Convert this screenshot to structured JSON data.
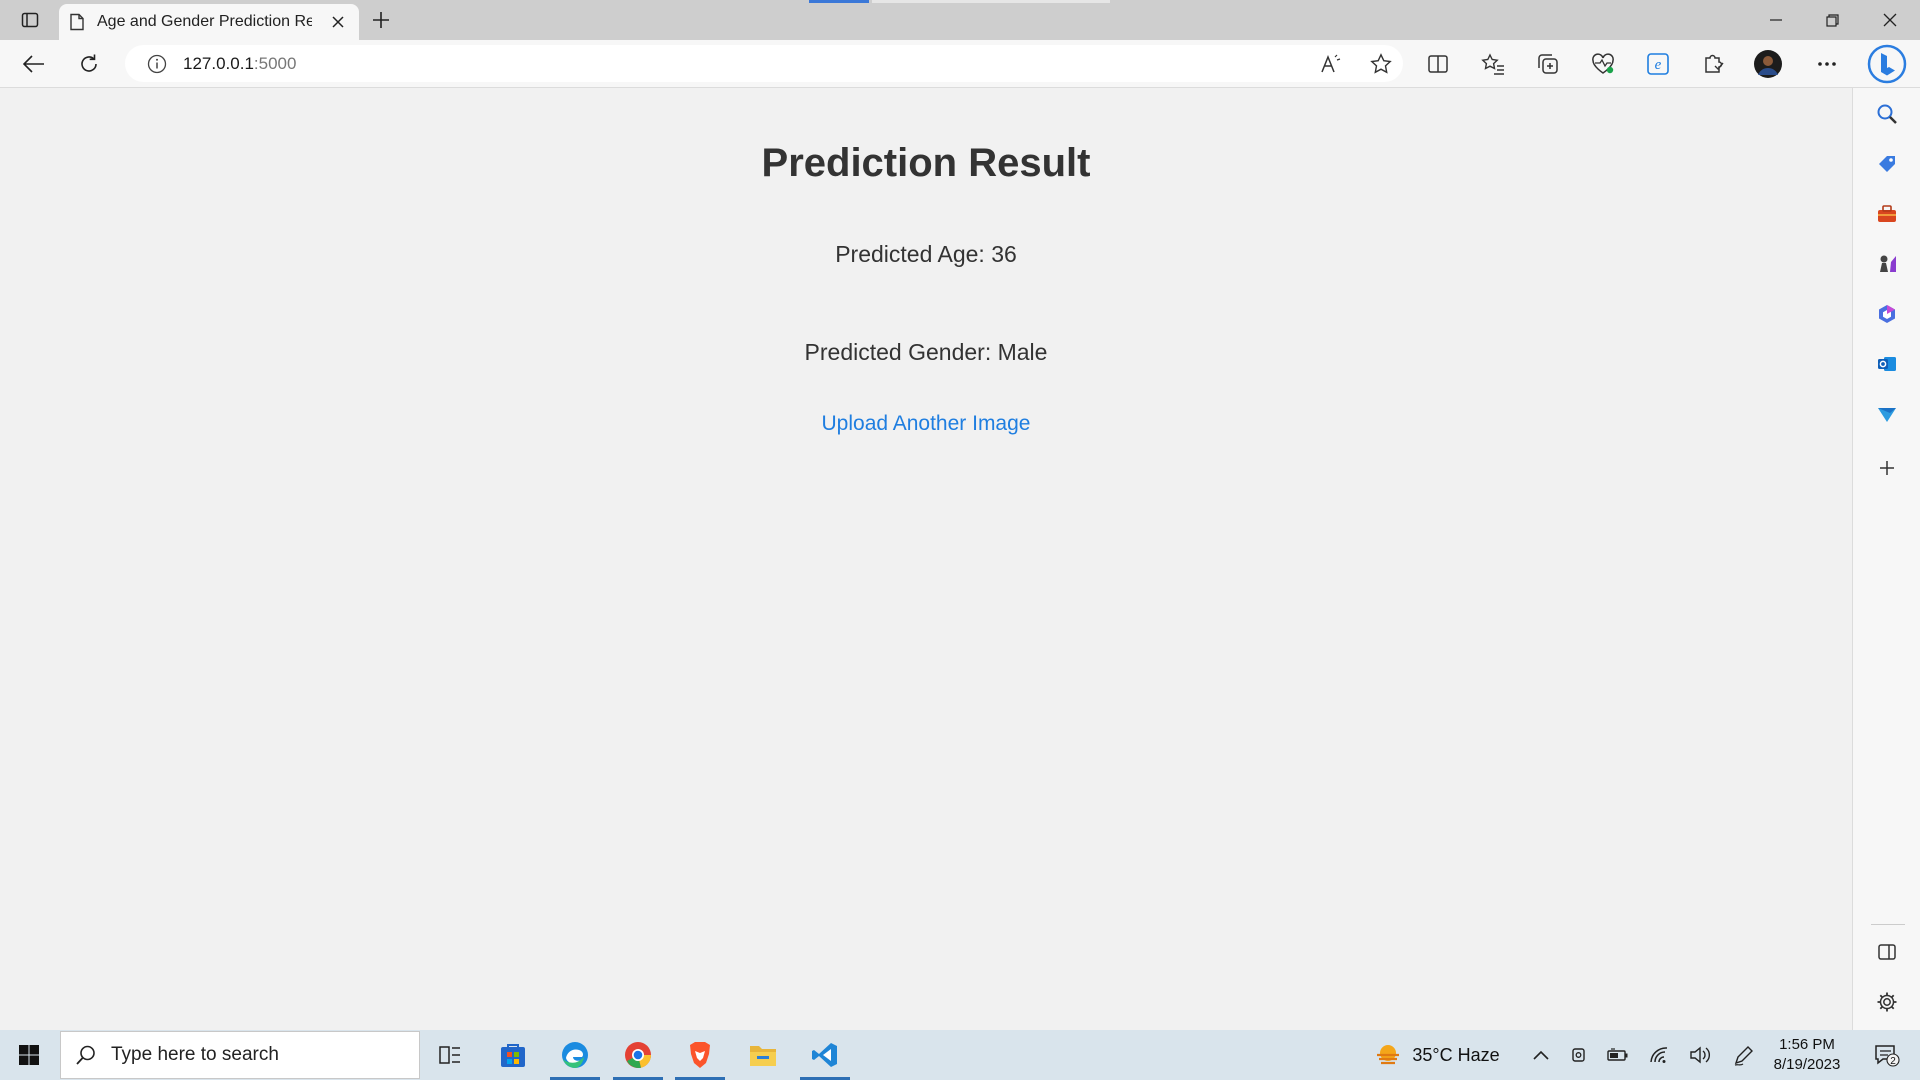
{
  "browser": {
    "tab_title": "Age and Gender Prediction Resul",
    "url_host": "127.0.0.1",
    "url_port": ":5000"
  },
  "page": {
    "title": "Prediction Result",
    "age_line": "Predicted Age: 36",
    "gender_line": "Predicted Gender: Male",
    "link_label": "Upload Another Image"
  },
  "taskbar": {
    "search_placeholder": "Type here to search",
    "weather": "35°C  Haze",
    "time": "1:56 PM",
    "date": "8/19/2023",
    "notification_count": "2"
  },
  "colors": {
    "accent_link": "#1f7ee0",
    "title_text": "#333333",
    "page_background": "#f1f1f1"
  }
}
